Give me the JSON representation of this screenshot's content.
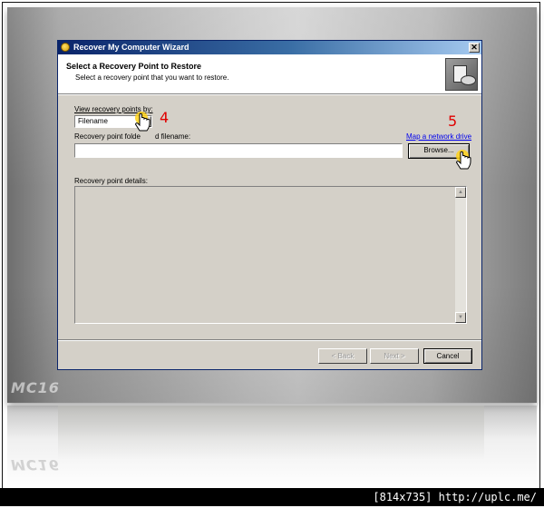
{
  "window": {
    "title": "Recover My Computer Wizard",
    "close_glyph": "✕",
    "header_title": "Select a Recovery Point to Restore",
    "header_subtitle": "Select a recovery point that you want to restore.",
    "header_icon": "recovery-disk-icon"
  },
  "form": {
    "view_by_label": "View recovery points by:",
    "view_by_value": "Filename",
    "folder_label_part1": "Recovery point folde",
    "folder_label_part2": "d filename:",
    "map_drive_link": "Map a network drive",
    "path_value": "",
    "browse_label": "Browse...",
    "details_label": "Recovery point details:"
  },
  "footer": {
    "back_label": "< Back",
    "next_label": "Next >",
    "cancel_label": "Cancel"
  },
  "annotations": {
    "step_4": "4",
    "step_5": "5"
  },
  "watermark": "MC16",
  "caption": "[814x735] http://uplc.me/",
  "colors": {
    "titlebar_start": "#0a246a",
    "titlebar_end": "#a6caf0",
    "dialog_face": "#d4d0c8",
    "annotation_red": "#e00000",
    "link_blue": "#0000ee"
  }
}
